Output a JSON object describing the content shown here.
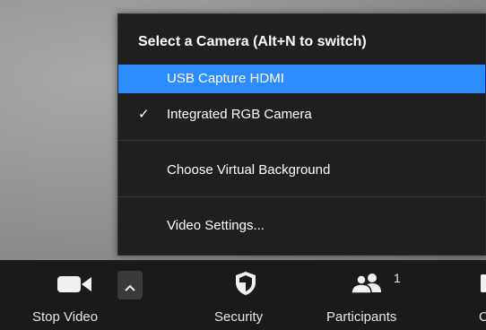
{
  "menu": {
    "title": "Select a Camera (Alt+N to switch)",
    "items": [
      {
        "label": "USB Capture HDMI",
        "selected": true,
        "checked": false
      },
      {
        "label": "Integrated RGB Camera",
        "selected": false,
        "checked": true
      },
      {
        "label": "Choose Virtual Background",
        "selected": false,
        "checked": false
      },
      {
        "label": "Video Settings...",
        "selected": false,
        "checked": false
      }
    ],
    "check_glyph": "✓"
  },
  "toolbar": {
    "stop_video_label": "Stop Video",
    "security_label": "Security",
    "participants_label": "Participants",
    "participants_count": "1",
    "cut_label": "C"
  },
  "colors": {
    "accent": "#2d8cff",
    "menu_bg": "#1f1f1f",
    "toolbar_bg": "#1a1a1a"
  },
  "icons": {
    "video": "video-camera-icon",
    "chevron": "chevron-up-icon",
    "security": "shield-icon",
    "participants": "participants-icon"
  }
}
